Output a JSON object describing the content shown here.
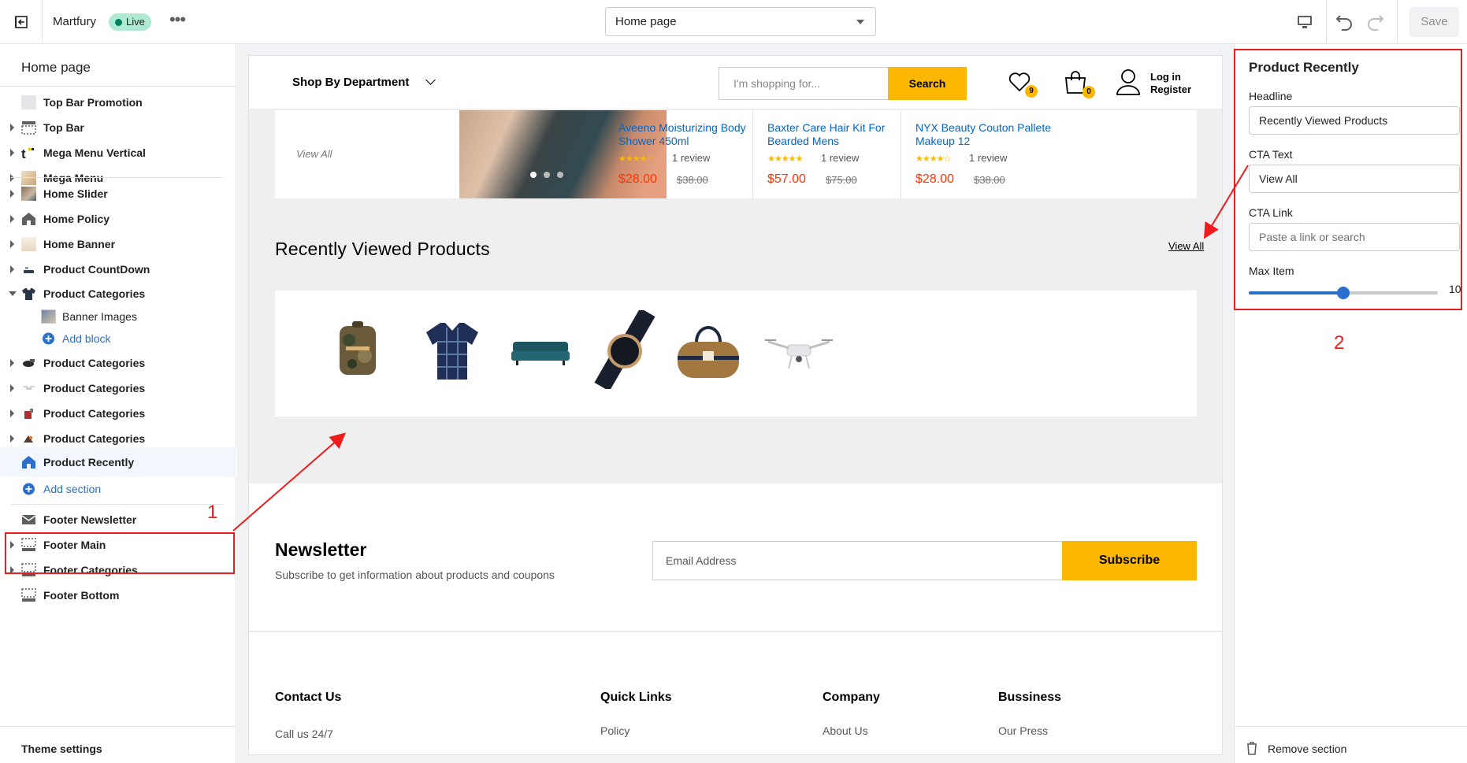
{
  "topbar": {
    "store_name": "Martfury",
    "live_label": "Live",
    "page_select": "Home page",
    "save_label": "Save"
  },
  "sidebar": {
    "title": "Home page",
    "items": [
      {
        "label": "Top Bar Promotion"
      },
      {
        "label": "Top Bar"
      },
      {
        "label": "Mega Menu Vertical"
      },
      {
        "label": "Mega Menu"
      },
      {
        "label": "Home Slider"
      },
      {
        "label": "Home Policy"
      },
      {
        "label": "Home Banner"
      },
      {
        "label": "Product CountDown"
      },
      {
        "label": "Product Categories"
      },
      {
        "label": "Banner Images"
      },
      {
        "label": "Add block"
      },
      {
        "label": "Product Categories"
      },
      {
        "label": "Product Categories"
      },
      {
        "label": "Product Categories"
      },
      {
        "label": "Product Categories"
      },
      {
        "label": "Product Recently"
      },
      {
        "label": "Add section"
      },
      {
        "label": "Footer Newsletter"
      },
      {
        "label": "Footer Main"
      },
      {
        "label": "Footer Categories"
      },
      {
        "label": "Footer Bottom"
      }
    ],
    "theme_settings": "Theme settings"
  },
  "preview": {
    "header": {
      "department": "Shop By Department",
      "search_placeholder": "I'm shopping for...",
      "search_button": "Search",
      "wishlist_count": "9",
      "cart_count": "0",
      "login": "Log in",
      "register": "Register"
    },
    "strip": {
      "view_all": "View All",
      "products": [
        {
          "name": "Aveeno Moisturizing Body Shower 450ml",
          "stars": "★★★★☆",
          "reviews": "1 review",
          "price": "$28.00",
          "old_price": "$38.00"
        },
        {
          "name": "Baxter Care Hair Kit For Bearded Mens",
          "stars": "★★★★★",
          "reviews": "1 review",
          "price": "$57.00",
          "old_price": "$75.00"
        },
        {
          "name": "NYX Beauty Couton Pallete Makeup 12",
          "stars": "★★★★☆",
          "reviews": "1 review",
          "price": "$28.00",
          "old_price": "$38.00"
        }
      ]
    },
    "recently": {
      "title": "Recently Viewed Products",
      "view_all": "View All"
    },
    "newsletter": {
      "title": "Newsletter",
      "subtitle": "Subscribe to get information about products and coupons",
      "placeholder": "Email Address",
      "button": "Subscribe"
    },
    "footer": {
      "columns": [
        {
          "heading": "Contact Us",
          "first": "Call us 24/7"
        },
        {
          "heading": "Quick Links",
          "first": "Policy"
        },
        {
          "heading": "Company",
          "first": "About Us"
        },
        {
          "heading": "Bussiness",
          "first": "Our Press"
        }
      ]
    }
  },
  "settings": {
    "title": "Product Recently",
    "headline_label": "Headline",
    "headline_value": "Recently Viewed Products",
    "cta_text_label": "CTA Text",
    "cta_text_value": "View All",
    "cta_link_label": "CTA Link",
    "cta_link_placeholder": "Paste a link or search",
    "max_item_label": "Max Item",
    "max_item_value": "10",
    "max_item_fraction": 0.5,
    "remove_label": "Remove section"
  },
  "annotations": {
    "label_1": "1",
    "label_2": "2",
    "color": "#ee1c1c"
  },
  "colors": {
    "accent": "#2c6ecb",
    "brand_yellow": "#fcb800",
    "price_red": "#ff3300",
    "link_blue": "#0066cc"
  }
}
